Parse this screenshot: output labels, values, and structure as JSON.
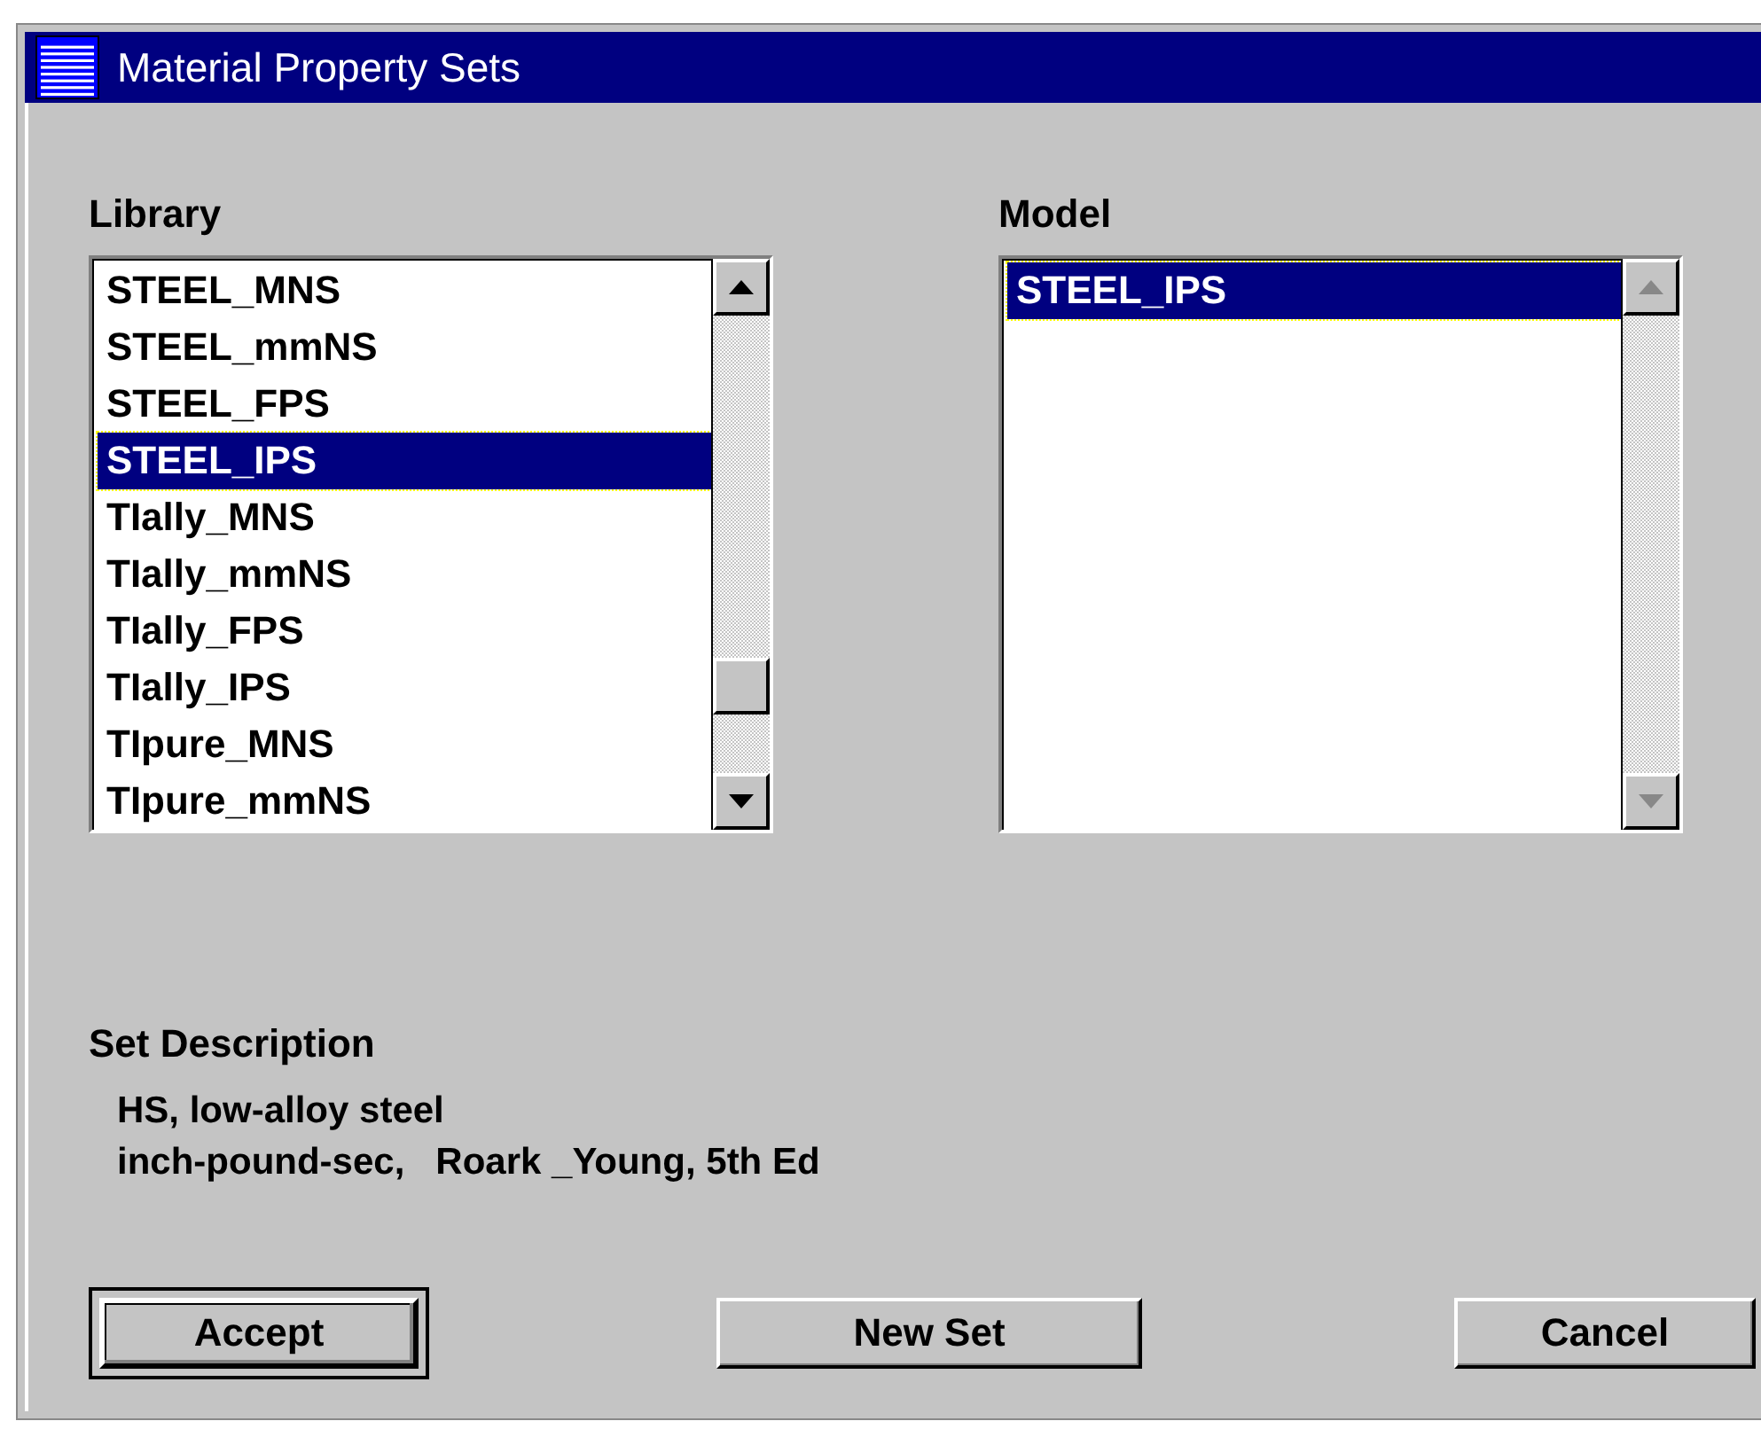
{
  "window": {
    "title": "Material Property Sets"
  },
  "library": {
    "label": "Library",
    "items": [
      {
        "label": "STEEL_MNS",
        "selected": false
      },
      {
        "label": "STEEL_mmNS",
        "selected": false
      },
      {
        "label": "STEEL_FPS",
        "selected": false
      },
      {
        "label": "STEEL_IPS",
        "selected": true
      },
      {
        "label": "TIally_MNS",
        "selected": false
      },
      {
        "label": "TIally_mmNS",
        "selected": false
      },
      {
        "label": "TIally_FPS",
        "selected": false
      },
      {
        "label": "TIally_IPS",
        "selected": false
      },
      {
        "label": "TIpure_MNS",
        "selected": false
      },
      {
        "label": "TIpure_mmNS",
        "selected": false
      }
    ]
  },
  "model": {
    "label": "Model",
    "items": [
      {
        "label": "STEEL_IPS",
        "selected": true
      }
    ]
  },
  "set_description": {
    "label": "Set Description",
    "lines": [
      "HS, low-alloy steel",
      "inch-pound-sec,   Roark _Young, 5th Ed"
    ]
  },
  "buttons": [
    {
      "label": "Accept",
      "default": true
    },
    {
      "label": "New Set",
      "default": false
    },
    {
      "label": "Cancel",
      "default": false
    }
  ]
}
